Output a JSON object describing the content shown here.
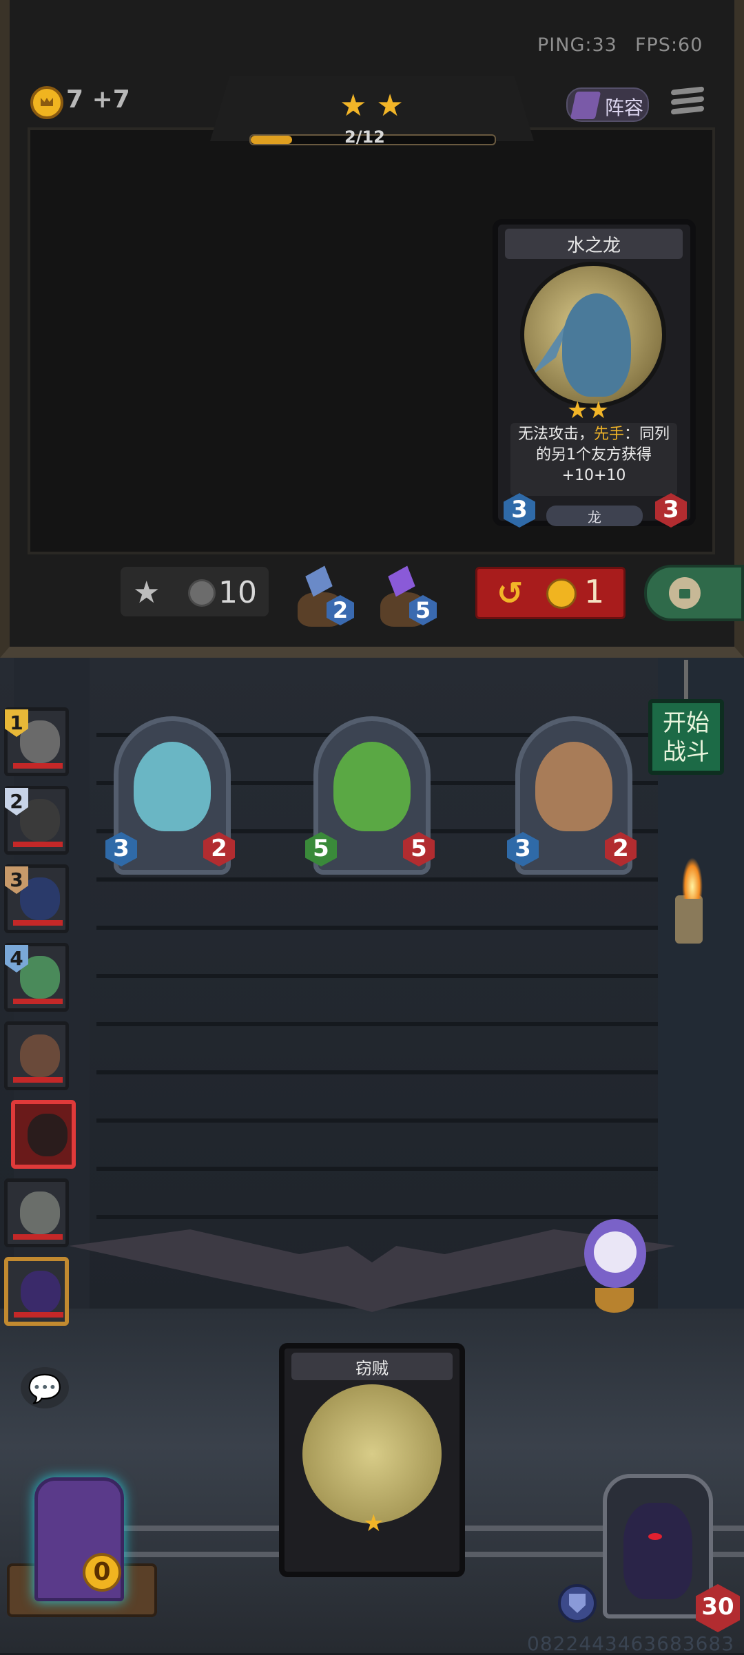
{
  "status": {
    "ping": "PING:33",
    "fps": "FPS:60"
  },
  "gold": {
    "text": "7 +7"
  },
  "tier": {
    "stars": "★ ★",
    "xp_text": "2/12",
    "xp_progress": 0.17
  },
  "lineup": {
    "label": "阵容"
  },
  "shop_card": {
    "title": "水之龙",
    "stars": "★★",
    "desc_part1": "无法攻击，",
    "desc_highlight": "先手",
    "desc_part2": "：同列的另1个友方获得+10+10",
    "tribe": "龙",
    "attack": "3",
    "health": "3"
  },
  "controls": {
    "upgrade_icon": "★",
    "upgrade_cost": "10",
    "bag_blue_count": "2",
    "bag_purple_count": "5",
    "reroll_icon": "↺",
    "reroll_cost": "1",
    "freeze_icon": "lock-icon"
  },
  "board_minions": [
    {
      "attack": "3",
      "health": "2",
      "color": "#6ab6c4"
    },
    {
      "attack": "5",
      "health": "5",
      "color": "#5aa844"
    },
    {
      "attack": "3",
      "health": "2",
      "color": "#a87c58"
    }
  ],
  "start_battle": {
    "label": "开始战斗"
  },
  "opponents": [
    {
      "rank": "1",
      "color": "#6a6a6a"
    },
    {
      "rank": "2",
      "color": "#3a3a3a"
    },
    {
      "rank": "3",
      "color": "#2a3a6a"
    },
    {
      "rank": "4",
      "color": "#4a8a5a"
    },
    {
      "rank": "",
      "color": "#6a4a3a"
    },
    {
      "rank": "",
      "color": "#2a1c1c"
    },
    {
      "rank": "",
      "color": "#6a6e6a"
    },
    {
      "rank": "",
      "color": "#3a2a6a"
    }
  ],
  "chat": {
    "icon": "💬"
  },
  "bottom_card": {
    "title": "窃贼",
    "star": "★"
  },
  "deck": {
    "count": "0"
  },
  "hero": {
    "health": "30"
  },
  "device_id": "0822443463683683"
}
